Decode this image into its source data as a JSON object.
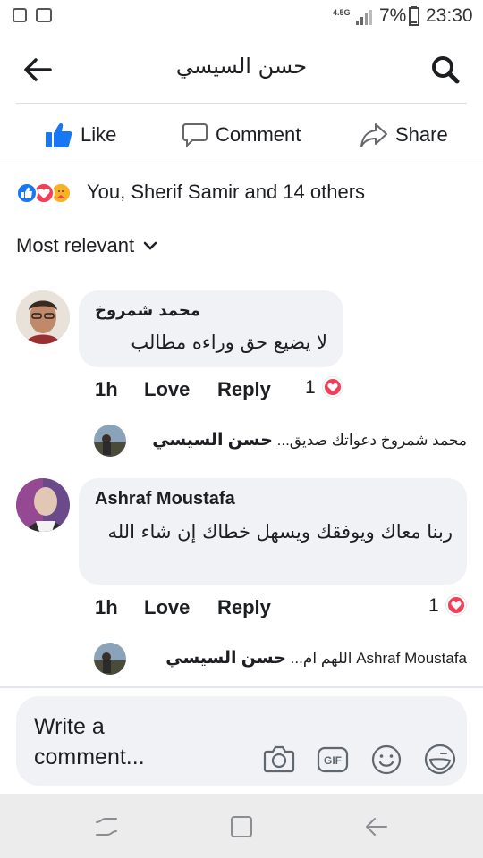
{
  "status_bar": {
    "network": "4.5G",
    "battery": "7%",
    "time": "23:30"
  },
  "header": {
    "title": "حسن السيسي",
    "back_icon": "back-arrow-icon",
    "search_icon": "search-icon"
  },
  "actions": {
    "like": "Like",
    "comment": "Comment",
    "share": "Share"
  },
  "reactions": {
    "summary": "You, Sherif Samir and 14 others",
    "icons": [
      "like-reaction-icon",
      "love-reaction-icon",
      "care-reaction-icon"
    ]
  },
  "sort": {
    "label": "Most relevant"
  },
  "comments": [
    {
      "author": "محمد شمروخ",
      "text": "لا يضيع حق وراءه مطالب",
      "time": "1h",
      "love_label": "Love",
      "reply_label": "Reply",
      "reaction_count": "1",
      "reply_author": "حسن السيسي",
      "reply_preview": "محمد شمروخ دعواتك صديق..."
    },
    {
      "author": "Ashraf Moustafa",
      "text": "ربنا معاك ويوفقك ويسهل خطاك إن شاء الله",
      "time": "1h",
      "love_label": "Love",
      "reply_label": "Reply",
      "reaction_count": "1",
      "reply_author": "حسن السيسي",
      "reply_preview": "Ashraf Moustafa اللهم ام..."
    }
  ],
  "composer": {
    "placeholder_line1": "Write a",
    "placeholder_line2": "comment...",
    "icons": [
      "camera-icon",
      "gif-icon",
      "emoji-icon",
      "sticker-icon"
    ]
  },
  "colors": {
    "facebook_blue": "#1877f2",
    "love_red": "#f33e58",
    "bubble_bg": "#f0f2f5"
  }
}
